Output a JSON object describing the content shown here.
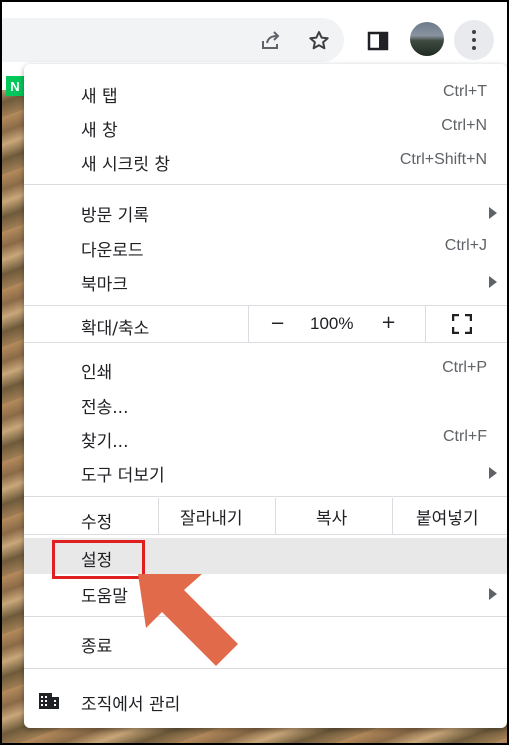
{
  "toolbar": {
    "icons": [
      "share-icon",
      "star-icon",
      "side-panel-icon",
      "profile-avatar",
      "more-menu-icon"
    ]
  },
  "page": {
    "badge": "N"
  },
  "menu": {
    "group1": [
      {
        "label": "새 탭",
        "shortcut": "Ctrl+T"
      },
      {
        "label": "새 창",
        "shortcut": "Ctrl+N"
      },
      {
        "label": "새 시크릿 창",
        "shortcut": "Ctrl+Shift+N"
      }
    ],
    "group2": [
      {
        "label": "방문 기록",
        "shortcut": ""
      },
      {
        "label": "다운로드",
        "shortcut": "Ctrl+J"
      },
      {
        "label": "북마크",
        "shortcut": ""
      }
    ],
    "zoom": {
      "label": "확대/축소",
      "minus": "−",
      "value": "100%",
      "plus": "+"
    },
    "group3": [
      {
        "label": "인쇄",
        "shortcut": "Ctrl+P"
      },
      {
        "label": "전송...",
        "shortcut": ""
      },
      {
        "label": "찾기...",
        "shortcut": "Ctrl+F"
      },
      {
        "label": "도구 더보기",
        "shortcut": ""
      }
    ],
    "edit": {
      "label": "수정",
      "cut": "잘라내기",
      "copy": "복사",
      "paste": "붙여넣기"
    },
    "settings": {
      "label": "설정"
    },
    "help": {
      "label": "도움말"
    },
    "exit": {
      "label": "종료"
    },
    "managed": {
      "label": "조직에서 관리"
    }
  },
  "colors": {
    "highlight_box": "#e02020",
    "arrow": "#e06040",
    "hover_bg": "#e8e8e8"
  }
}
